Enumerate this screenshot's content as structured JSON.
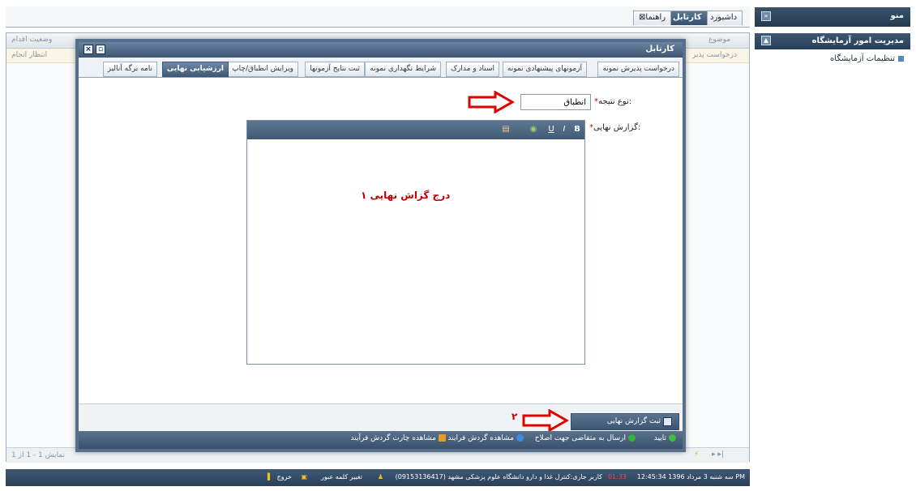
{
  "side_menu": {
    "header_title": "منو",
    "group_title": "مدیریت امور آزمایشگاه",
    "items": [
      {
        "label": "تنظیمات آزمایشگاه"
      }
    ]
  },
  "main_tabs": [
    {
      "label": "داشبورد"
    },
    {
      "label": "کارتابل"
    },
    {
      "label": "راهنما"
    }
  ],
  "background_grid": {
    "columns": [
      {
        "label": "وضعیت اقدام"
      },
      {
        "label": "موضوع"
      }
    ],
    "row": {
      "status": "انتظار انجام",
      "subject": "درخواست پذیر"
    },
    "pager": "نمایش 1 - 1 از 1"
  },
  "modal": {
    "title": "کارتابل",
    "tabs": [
      {
        "label": "درخواست پذیرش نمونه"
      },
      {
        "label": "آزمونهای پیشنهادی نمونه"
      },
      {
        "label": "اسناد و مدارک"
      },
      {
        "label": "شرایط نگهداری نمونه"
      },
      {
        "label": "ثبت نتایج آزمونها"
      },
      {
        "label": "ویرایش انطباق/چاپ"
      },
      {
        "label": "ارزشیابی نهایی"
      },
      {
        "label": "نامه برگه آنالیز"
      }
    ],
    "result_type": {
      "label": "نوع نتیجه:",
      "value": "انطباق",
      "required": "*"
    },
    "final_report": {
      "label": "گزارش نهایی:",
      "required": "*",
      "toolbar": [
        "B",
        "I",
        "U"
      ],
      "annotation": "درج گزاش نهایی   ۱"
    },
    "submit_label": "ثبت گزارش نهایی",
    "submit_annotation": "۲",
    "actions": [
      {
        "label": "تایید",
        "color": "#3fbf3f"
      },
      {
        "label": "ارسال به متقاضی جهت اصلاح",
        "color": "#35b535"
      },
      {
        "label": "مشاهده گردش فرایند",
        "color": "#3d8be0"
      },
      {
        "label": "مشاهده چارت گردش فرآیند",
        "color": "#e0a020"
      }
    ]
  },
  "status_bar": {
    "datetime": "سه شنبه 3 مرداد 1396 12:45:34 PM",
    "timer": "01:33",
    "user": "کاربر جاری:کنترل غذا و دارو دانشگاه علوم پزشکی مشهد (09153136417)",
    "change_password": "تغییر کلمه عبور",
    "logout": "خروج"
  },
  "colors": {
    "arrow_red": "#e00000",
    "header_blue": "#3b5573"
  }
}
